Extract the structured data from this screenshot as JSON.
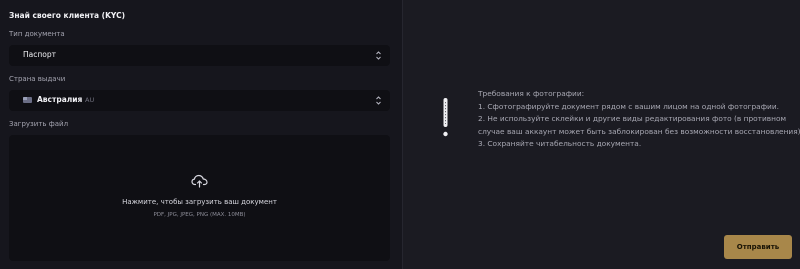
{
  "form": {
    "title": "Знай своего клиента (KYC)",
    "document_type": {
      "label": "Тип документа",
      "value": "Паспорт"
    },
    "country": {
      "label": "Страна выдачи",
      "name": "Австралия",
      "code": "AU"
    },
    "upload": {
      "label": "Загрузить файл",
      "prompt": "Нажмите, чтобы загрузить ваш документ",
      "formats": "PDF, JPG, JPEG, PNG (MAX. 10MB)"
    }
  },
  "requirements": {
    "title": "Требования к фотографии:",
    "items": [
      "1. Сфотографируйте документ рядом с вашим лицом на одной фотографии.",
      "2. Не используйте склейки и другие виды редактирования фото (в противном",
      "случае ваш аккаунт может быть заблокирован без возможности восстановления).",
      "3. Сохраняйте читабельность документа."
    ]
  },
  "actions": {
    "submit_label": "Отправить"
  },
  "colors": {
    "background": "#16161d",
    "panel_right": "#1b1b22",
    "field_bg": "#0f0f14",
    "accent_button": "#a8874a"
  },
  "icons": {
    "chevron": "chevron-up-down-icon",
    "upload": "cloud-upload-icon",
    "notice": "exclamation-icon",
    "flag": "australia-flag-icon"
  }
}
